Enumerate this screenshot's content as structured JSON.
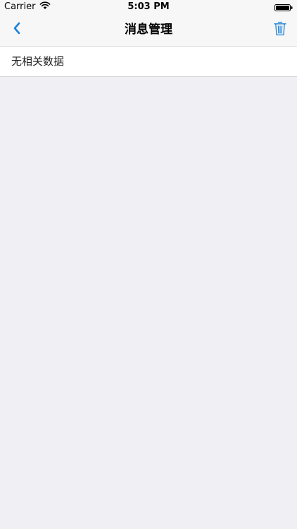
{
  "status_bar": {
    "carrier": "Carrier",
    "time": "5:03 PM",
    "icons": [
      "wifi-icon",
      "battery-icon"
    ]
  },
  "nav": {
    "back_icon": "chevron-left-icon",
    "title": "消息管理",
    "trash_icon": "trash-icon",
    "accent_color": "#1a82d8"
  },
  "content": {
    "empty_message": "无相关数据"
  }
}
